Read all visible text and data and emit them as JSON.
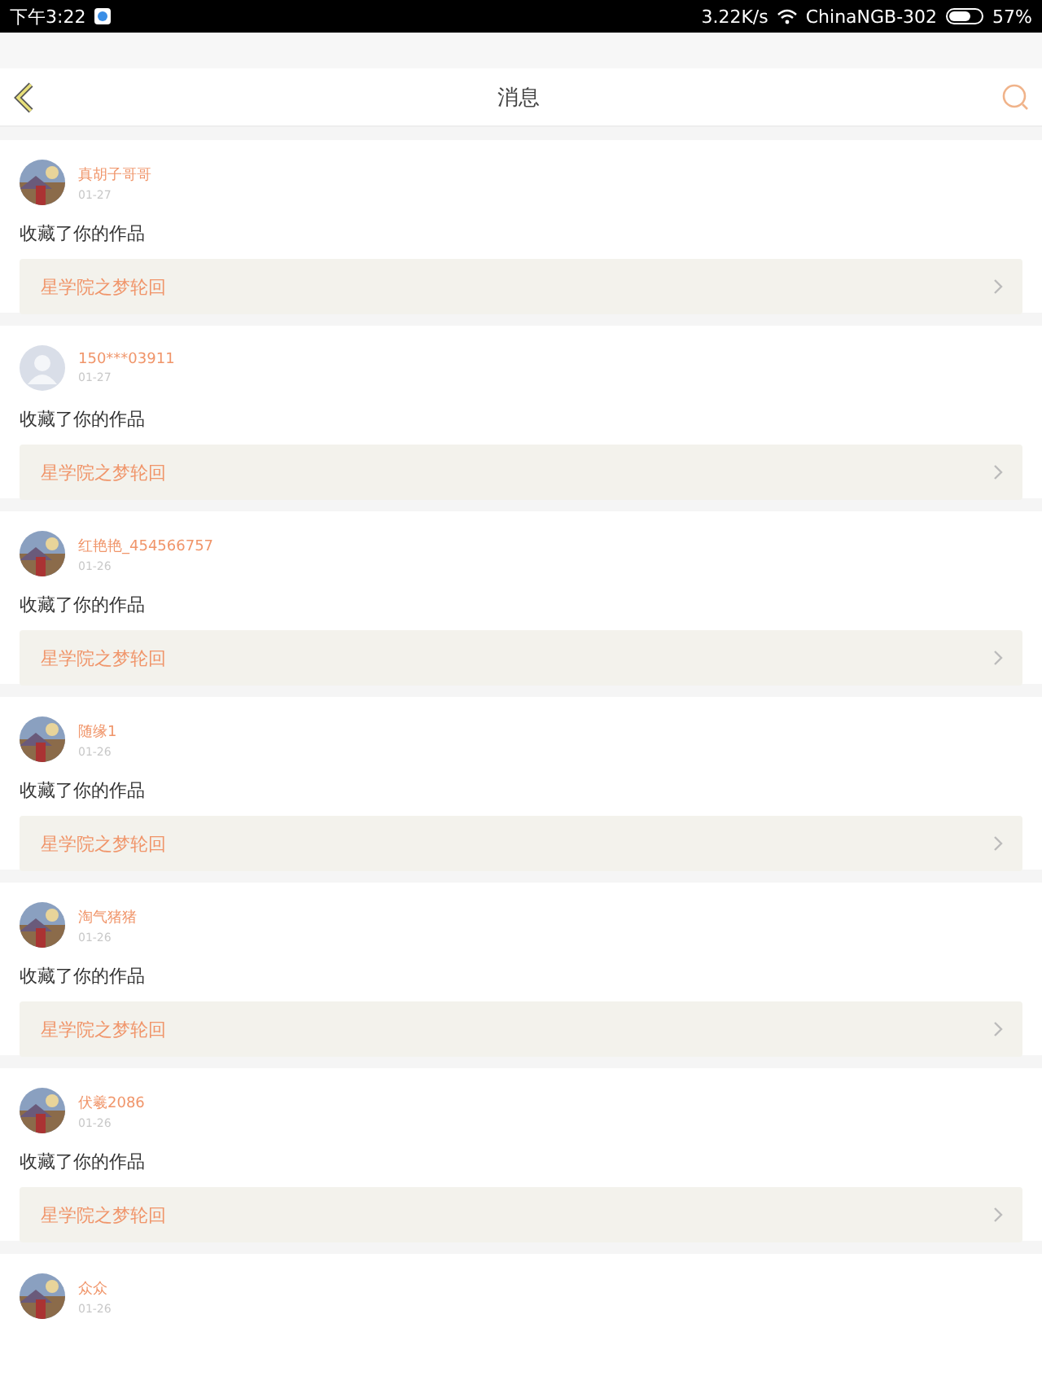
{
  "status_bar": {
    "time": "下午3:22",
    "speed": "3.22K/s",
    "network": "ChinaNGB-302",
    "battery": "57%"
  },
  "header": {
    "title": "消息"
  },
  "messages": [
    {
      "user": "真胡子哥哥",
      "date": "01-27",
      "action": "收藏了你的作品",
      "work": "星学院之梦轮回"
    },
    {
      "user": "150***03911",
      "date": "01-27",
      "action": "收藏了你的作品",
      "work": "星学院之梦轮回",
      "avatar": {
        "kind": "default"
      }
    },
    {
      "user": "红艳艳_454566757",
      "date": "01-26",
      "action": "收藏了你的作品",
      "work": "星学院之梦轮回"
    },
    {
      "user": "随缘1",
      "date": "01-26",
      "action": "收藏了你的作品",
      "work": "星学院之梦轮回"
    },
    {
      "user": "淘气猪猪",
      "date": "01-26",
      "action": "收藏了你的作品",
      "work": "星学院之梦轮回"
    },
    {
      "user": "伏羲2086",
      "date": "01-26",
      "action": "收藏了你的作品",
      "work": "星学院之梦轮回"
    },
    {
      "user": "众众",
      "date": "01-26"
    }
  ]
}
